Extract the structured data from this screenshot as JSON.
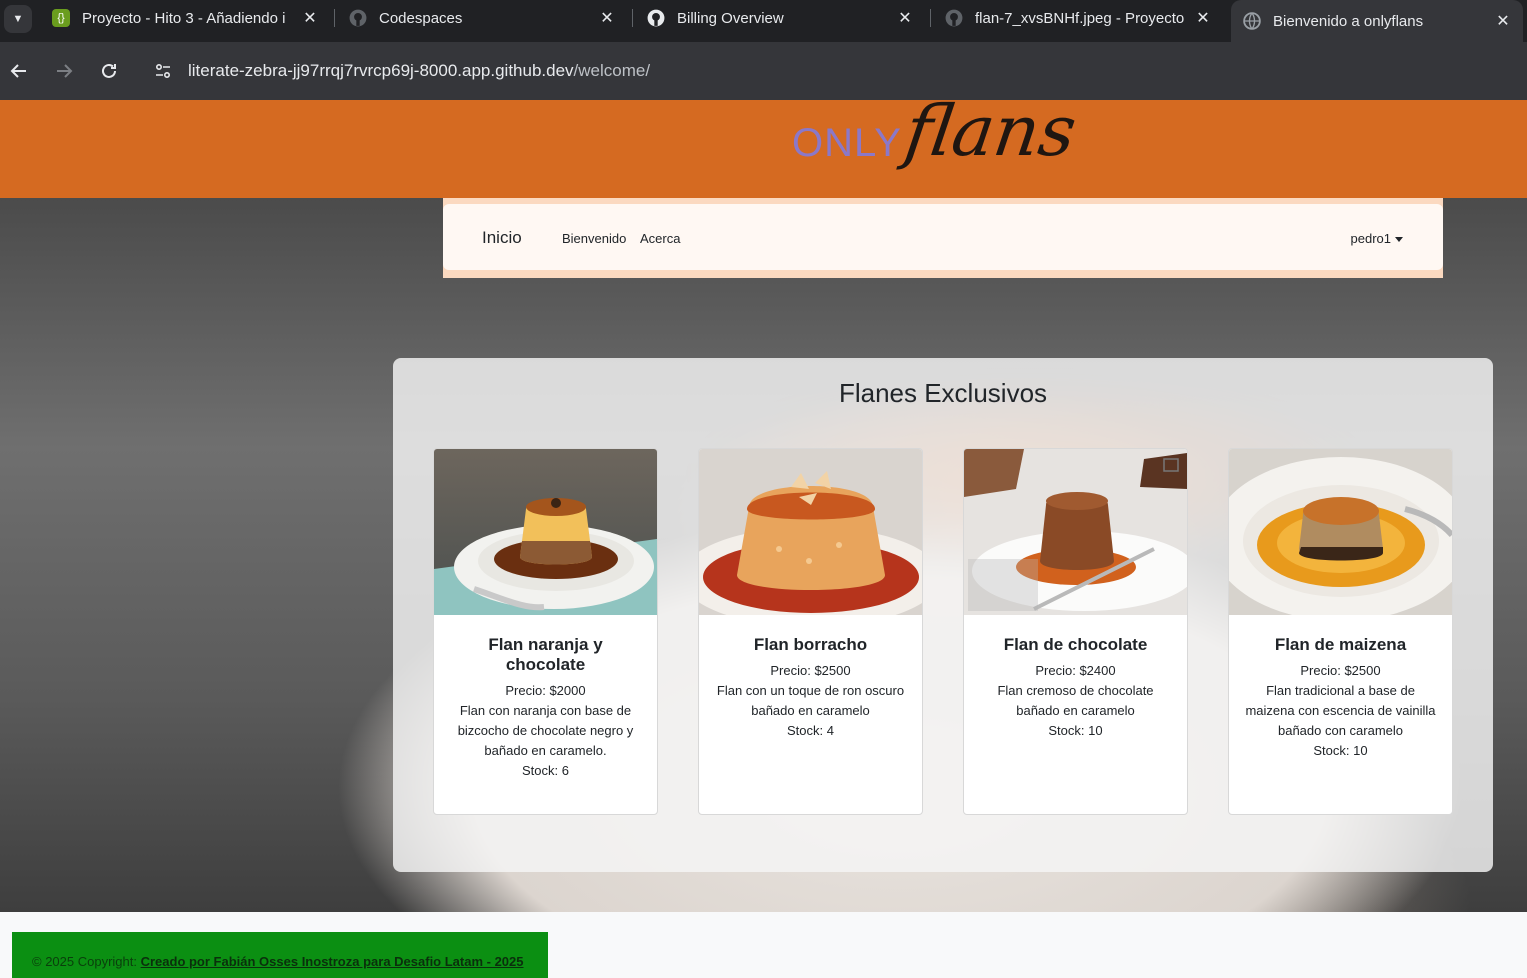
{
  "browser": {
    "tabs": [
      {
        "title": "Proyecto - Hito 3 - Añadiendo i",
        "favicon": "brackets-icon",
        "favicon_color": "#6a9d1e"
      },
      {
        "title": "Codespaces",
        "favicon": "github-icon",
        "favicon_color": "#5f6368"
      },
      {
        "title": "Billing Overview",
        "favicon": "github-icon",
        "favicon_color": "#e8eaed"
      },
      {
        "title": "flan-7_xvsBNHf.jpeg - Proyecto",
        "favicon": "github-icon",
        "favicon_color": "#5f6368"
      },
      {
        "title": "Bienvenido a onlyflans",
        "favicon": "globe-icon",
        "favicon_color": "#9aa0a6"
      }
    ],
    "close_glyph": "✕",
    "url_host": "literate-zebra-jj97rrqj7rvrcp69j-8000.app.github.dev",
    "url_path": "/welcome/"
  },
  "logo": {
    "only": "ONLY",
    "flans": "flans"
  },
  "nav": {
    "brand": "Inicio",
    "links": [
      "Bienvenido",
      "Acerca"
    ],
    "user": "pedro1"
  },
  "main": {
    "title": "Flanes Exclusivos",
    "cards": [
      {
        "name": "Flan naranja y chocolate",
        "price": "Precio: $2000",
        "description": "Flan con naranja con base de bizcocho de chocolate negro y bañado en caramelo.",
        "stock": "Stock: 6"
      },
      {
        "name": "Flan borracho",
        "price": "Precio: $2500",
        "description": "Flan con un toque de ron oscuro bañado en caramelo",
        "stock": "Stock: 4"
      },
      {
        "name": "Flan de chocolate",
        "price": "Precio: $2400",
        "description": "Flan cremoso de chocolate bañado en caramelo",
        "stock": "Stock: 10"
      },
      {
        "name": "Flan de maizena",
        "price": "Precio: $2500",
        "description": "Flan tradicional a base de maizena con escencia de vainilla bañado con caramelo",
        "stock": "Stock: 10"
      }
    ]
  },
  "footer": {
    "prefix": "© 2025 Copyright: ",
    "link": "Creado por Fabián Osses Inostroza para Desafio Latam - 2025"
  },
  "colors": {
    "header": "#d56a21",
    "logo_only": "#8b78c8",
    "footer": "#0b8f12"
  }
}
